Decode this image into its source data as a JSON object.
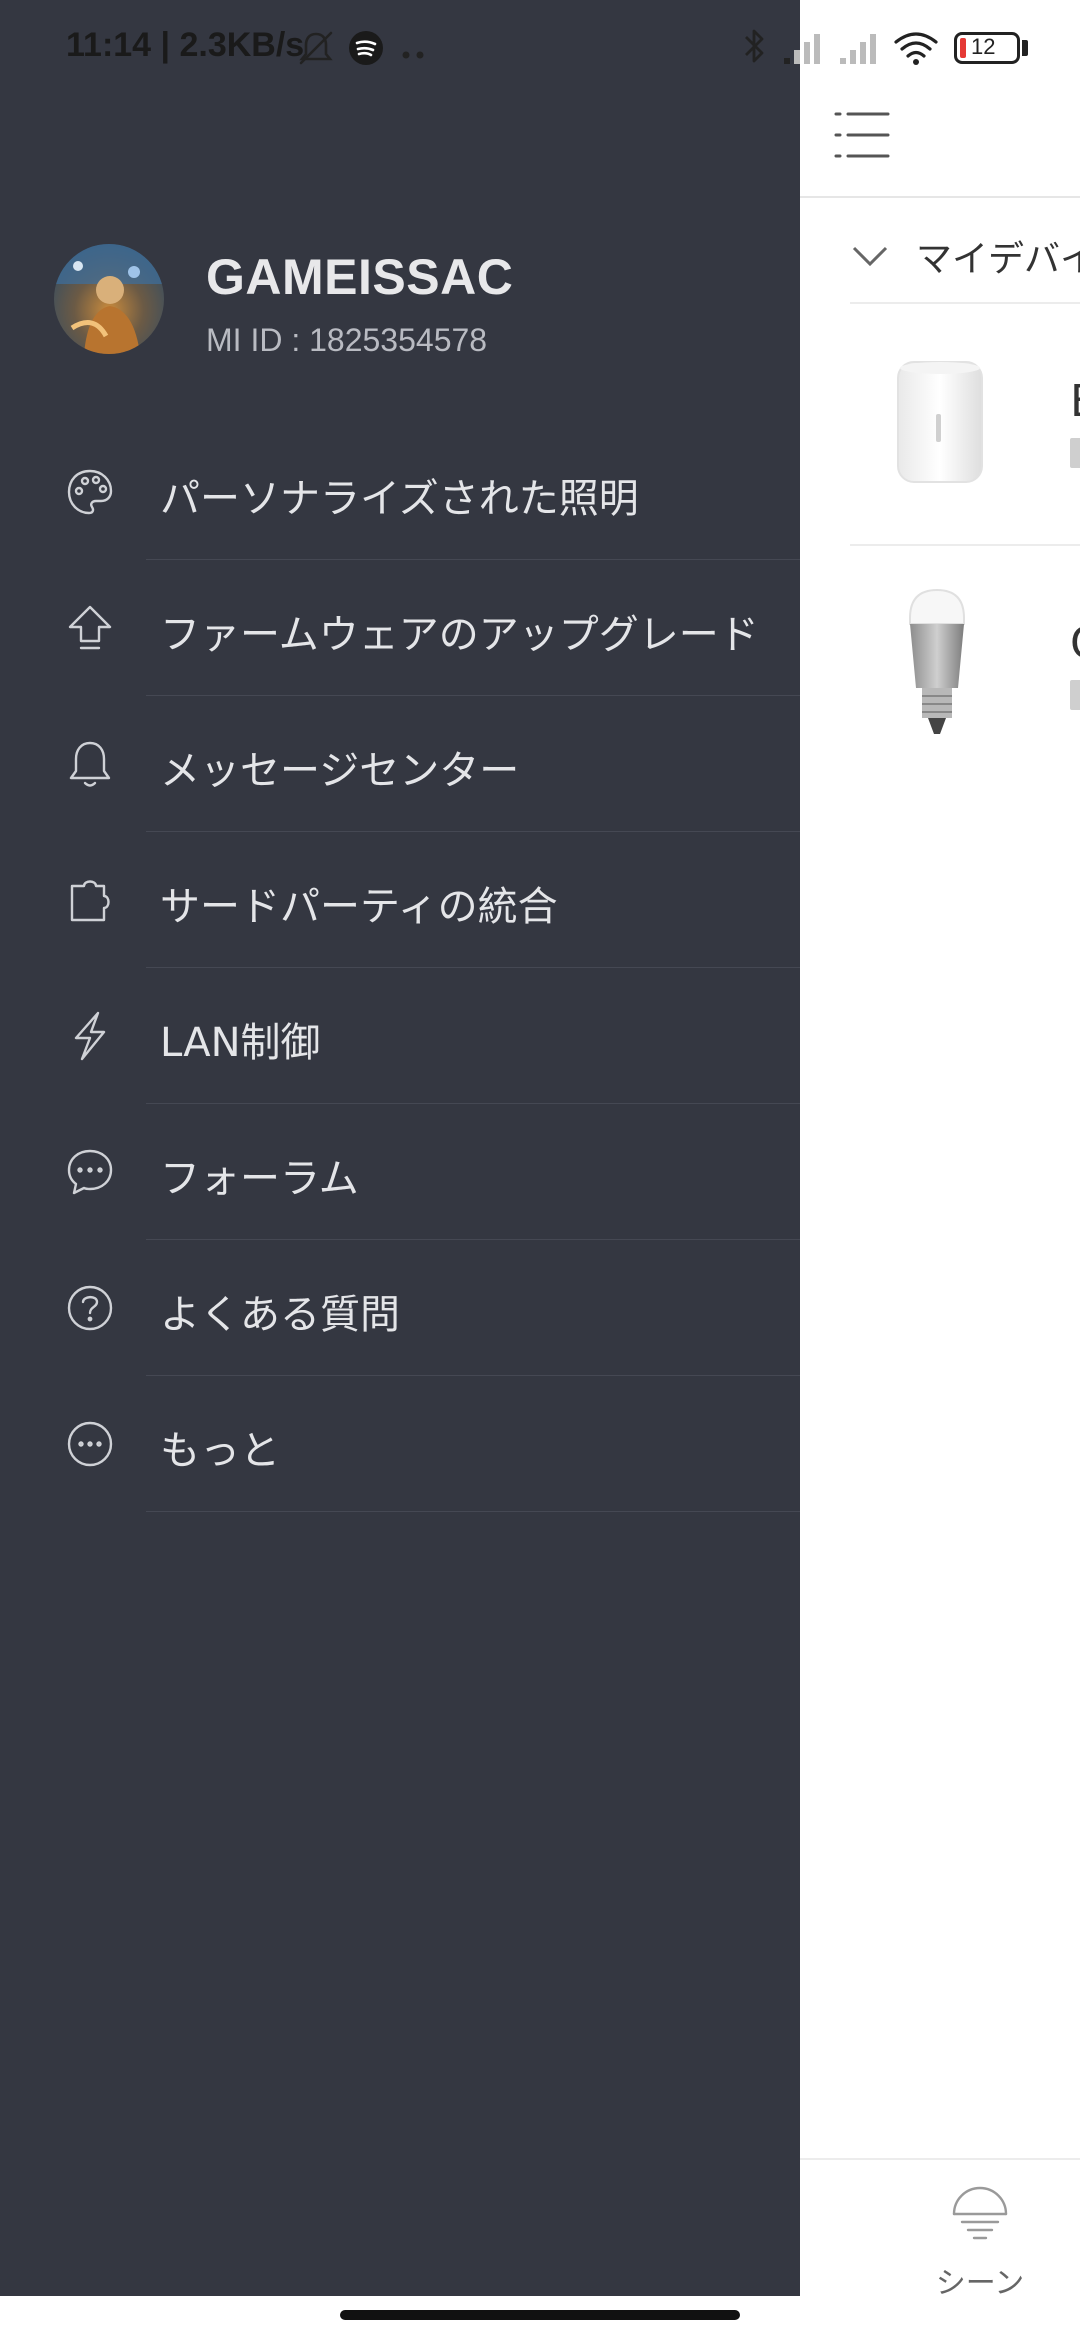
{
  "status_bar": {
    "time": "11:14 | 2.3KB/s",
    "battery": "12",
    "icons": [
      "mute-icon",
      "spotify-icon",
      "more-dots-icon",
      "bluetooth-icon",
      "signal-icon",
      "signal-icon",
      "wifi-icon",
      "battery-icon"
    ]
  },
  "profile": {
    "username": "GAMEISSAC",
    "mi_id": "MI ID : 1825354578"
  },
  "menu": [
    {
      "label": "パーソナライズされた照明",
      "icon": "palette-icon"
    },
    {
      "label": "ファームウェアのアップグレード",
      "icon": "upgrade-arrow-icon"
    },
    {
      "label": "メッセージセンター",
      "icon": "bell-icon"
    },
    {
      "label": "サードパーティの統合",
      "icon": "puzzle-icon"
    },
    {
      "label": "LAN制御",
      "icon": "lightning-icon"
    },
    {
      "label": "フォーラム",
      "icon": "chat-bubble-icon"
    },
    {
      "label": "よくある質問",
      "icon": "question-icon"
    },
    {
      "label": "もっと",
      "icon": "more-icon"
    }
  ],
  "background": {
    "section_title": "マイデバイ",
    "devices": [
      {
        "name_stub": "B",
        "icon": "bedside-lamp-image"
      },
      {
        "name_stub": "C",
        "icon": "bulb-image"
      }
    ],
    "bottom_nav": {
      "scene_label": "シーン"
    }
  },
  "colors": {
    "drawer_bg": "#343741",
    "drawer_text": "#e4e5e8",
    "battery_low": "#e53935"
  }
}
